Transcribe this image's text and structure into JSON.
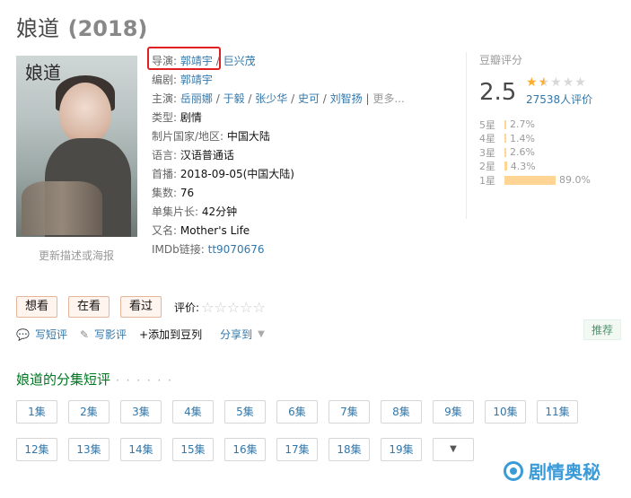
{
  "title": {
    "name": "娘道",
    "year": "(2018)"
  },
  "poster": {
    "calligraphy": "娘道",
    "caption": "更新描述或海报"
  },
  "info": {
    "director_label": "导演:",
    "directors": [
      "郭靖宇",
      "巨兴茂"
    ],
    "writer_label": "编剧:",
    "writer": "郭靖宇",
    "cast_label": "主演:",
    "cast": [
      "岳丽娜",
      "于毅",
      "张少华",
      "史可",
      "刘智扬"
    ],
    "cast_more": "更多...",
    "genre_label": "类型:",
    "genre": "剧情",
    "country_label": "制片国家/地区:",
    "country": "中国大陆",
    "language_label": "语言:",
    "language": "汉语普通话",
    "premiere_label": "首播:",
    "premiere": "2018-09-05(中国大陆)",
    "episodes_label": "集数:",
    "episodes_count": "76",
    "runtime_label": "单集片长:",
    "runtime": "42分钟",
    "aka_label": "又名:",
    "aka": "Mother's Life",
    "imdb_label": "IMDb链接:",
    "imdb": "tt9070676"
  },
  "rating": {
    "heading": "豆瓣评分",
    "score": "2.5",
    "stars_filled": 1,
    "count": "27538人评价",
    "distribution": [
      {
        "label": "5星",
        "percent": "2.7%",
        "value": 2.7
      },
      {
        "label": "4星",
        "percent": "1.4%",
        "value": 1.4
      },
      {
        "label": "3星",
        "percent": "2.6%",
        "value": 2.6
      },
      {
        "label": "2星",
        "percent": "4.3%",
        "value": 4.3
      },
      {
        "label": "1星",
        "percent": "89.0%",
        "value": 89.0
      }
    ]
  },
  "actions": {
    "want": "想看",
    "watching": "在看",
    "watched": "看过",
    "rate_label": "评价:"
  },
  "links": {
    "short_review": "写短评",
    "review": "写影评",
    "add_list": "+添加到豆列",
    "share": "分享到"
  },
  "recommend": "推荐",
  "episode_section": {
    "title": "娘道的分集短评",
    "dots": "· · · · · ·"
  },
  "episodes": [
    "1集",
    "2集",
    "3集",
    "4集",
    "5集",
    "6集",
    "7集",
    "8集",
    "9集",
    "10集",
    "11集",
    "12集",
    "13集",
    "14集",
    "15集",
    "16集",
    "17集",
    "18集",
    "19集"
  ],
  "episodes_more": "▼",
  "watermark": "剧情奥秘",
  "colors": {
    "link": "#3377aa",
    "highlight_box": "#e02020",
    "star": "#ffac2d",
    "bar": "#ffd596",
    "section": "#007722"
  }
}
